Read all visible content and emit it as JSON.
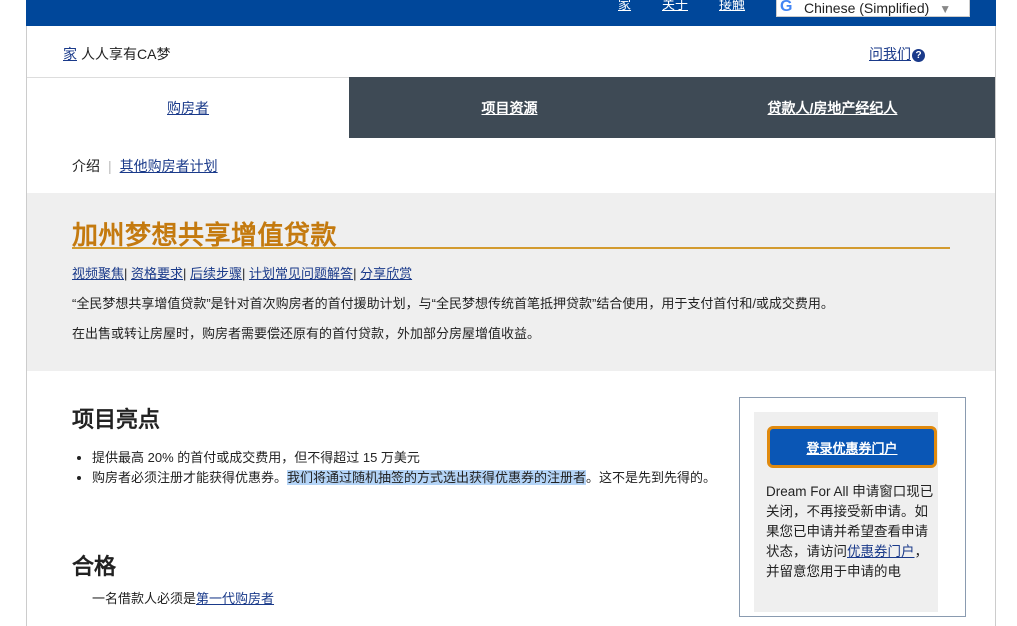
{
  "topbar": {
    "links": [
      "家",
      "关于",
      "接触"
    ],
    "translate": {
      "language": "Chinese (Simplified)",
      "icon": "google-g-icon"
    }
  },
  "crumb": {
    "home": "家",
    "text": "人人享有CA梦",
    "ask": "问我们",
    "ask_icon": "question-circle-icon"
  },
  "tabs": [
    "购房者",
    "项目资源",
    "贷款人/房地产经纪人"
  ],
  "subnav": {
    "current": "介绍",
    "link": "其他购房者计划"
  },
  "hero": {
    "title": "加州梦想共享增值贷款",
    "jump_links": [
      "视频聚焦",
      "资格要求",
      "后续步骤",
      "计划常见问题解答",
      "分享欣赏"
    ],
    "p1": "“全民梦想共享增值贷款”是针对首次购房者的首付援助计划，与“全民梦想传统首笔抵押贷款”结合使用，用于支付首付和/或成交费用。",
    "p2": "在出售或转让房屋时，购房者需要偿还原有的首付贷款，外加部分房屋增值收益。"
  },
  "highlights": {
    "heading": "项目亮点",
    "item1": "提供最高 20% 的首付或成交费用，但不得超过 15 万美元",
    "item2_pre": "购房者必须注册才能获得优惠券。",
    "item2_hl": "我们将通过随机抽签的方式选出获得优惠券的注册者",
    "item2_post": "。这不是先到先得的。"
  },
  "eligibility": {
    "heading": "合格",
    "cut_pre": "一名借款人必须是",
    "cut_link": "第一代购房者"
  },
  "sidebar": {
    "button": "登录优惠券门户",
    "text_pre": "Dream For All 申请窗口现已关闭，不再接受新申请。如果您已申请并希望查看申请状态，请访问",
    "text_link": "优惠券门户",
    "text_post": "，并留意您用于申请的电"
  },
  "colors": {
    "brand_blue": "#00479a",
    "title_gold": "#c47a0f",
    "tab_dark": "#3e4a55",
    "button_border": "#e08a0f"
  }
}
